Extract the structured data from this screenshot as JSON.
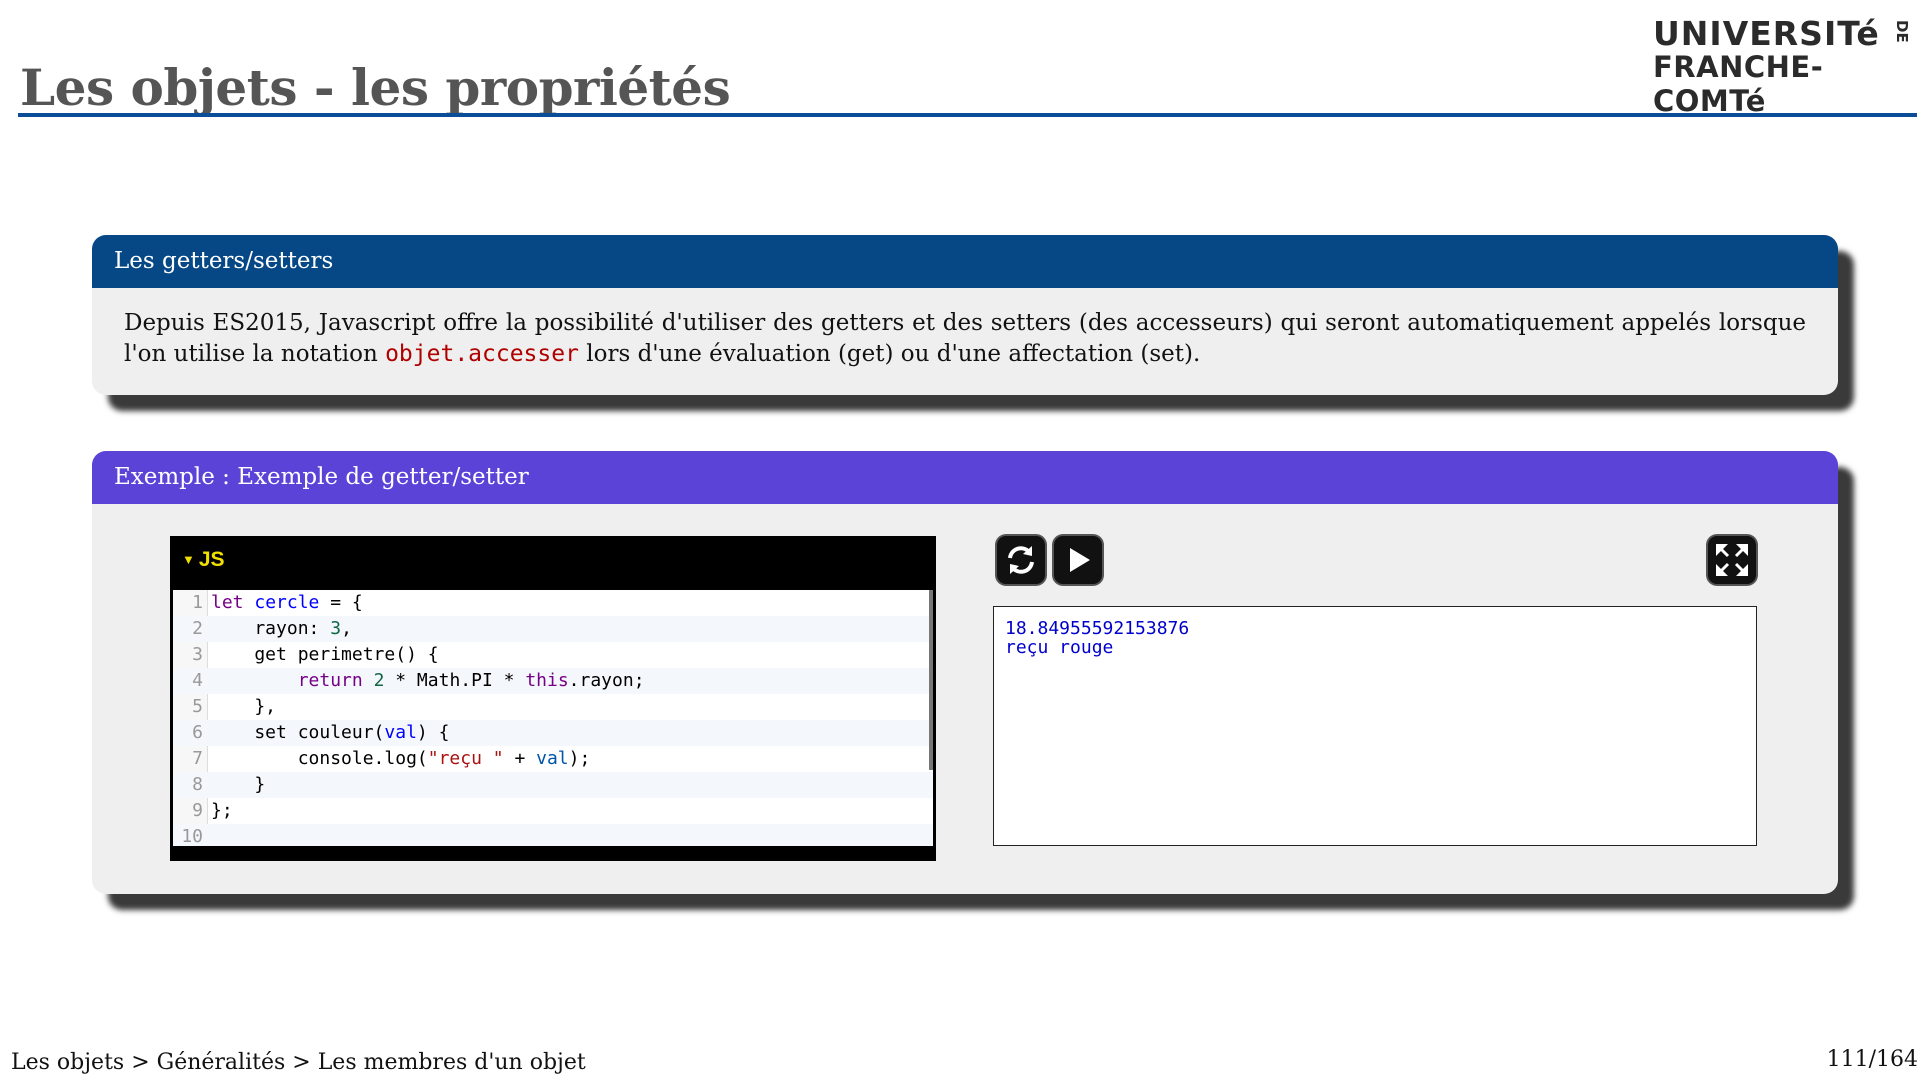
{
  "slide": {
    "title": "Les objets - les propriétés",
    "logo": {
      "line1": "UNIVERSITé",
      "line2": "FRANCHE-COMTé",
      "de": "DE"
    },
    "colors": {
      "title_rule": "#0b4d96",
      "definition_header": "#064785",
      "example_header": "#5b43d8"
    }
  },
  "definition": {
    "title": "Les getters/setters",
    "text_before": "Depuis ES2015, Javascript offre la possibilité d'utiliser des getters et des setters (des accesseurs) qui seront automatiquement appelés lorsque l'on utilise la notation ",
    "code": "objet.accesser",
    "text_after": " lors d'une évaluation (get) ou d'une affectation (set)."
  },
  "example": {
    "title": "Exemple : Exemple de getter/setter",
    "editor": {
      "language": "JS",
      "lines": [
        "1",
        "2",
        "3",
        "4",
        "5",
        "6",
        "7",
        "8",
        "9",
        "10"
      ]
    },
    "buttons": {
      "reload": "reload-icon",
      "run": "play-icon",
      "fullscreen": "expand-icon"
    },
    "output": {
      "line1": "18.84955592153876",
      "line2": "reçu rouge"
    }
  },
  "footer": {
    "breadcrumb": "Les objets > Généralités > Les membres d'un objet",
    "page": "111/164"
  }
}
